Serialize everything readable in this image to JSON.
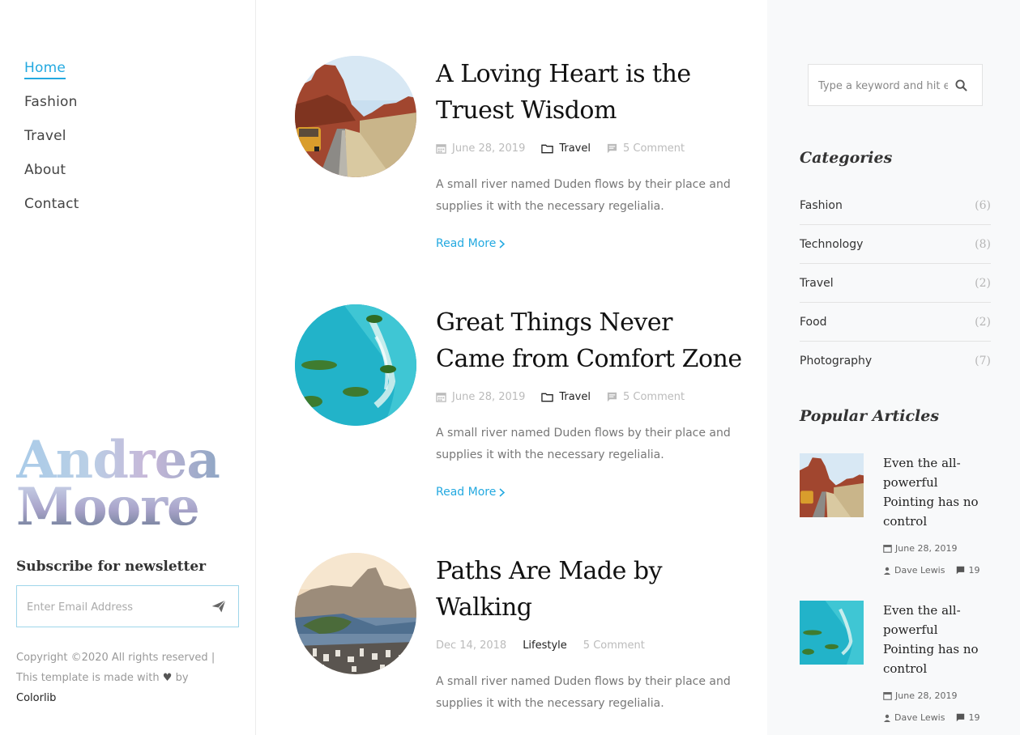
{
  "nav": {
    "items": [
      {
        "label": "Home",
        "active": true
      },
      {
        "label": "Fashion",
        "active": false
      },
      {
        "label": "Travel",
        "active": false
      },
      {
        "label": "About",
        "active": false
      },
      {
        "label": "Contact",
        "active": false
      }
    ]
  },
  "brand": {
    "line1": "Andrea",
    "line2": "Moore"
  },
  "newsletter": {
    "title": "Subscribe for newsletter",
    "placeholder": "Enter Email Address",
    "send_icon": "paper-plane-icon"
  },
  "footer": {
    "copyright": "Copyright ©2020 All rights reserved | This template is made with",
    "heart": "♥",
    "by": "by",
    "link": "Colorlib"
  },
  "posts": [
    {
      "title": "A Loving Heart is the Truest Wisdom",
      "date": "June 28, 2019",
      "category": "Travel",
      "comments": "5 Comment",
      "excerpt": "A small river named Duden flows by their place and supplies it with the necessary regelialia.",
      "read_more": "Read More",
      "image": "canyon-road-van"
    },
    {
      "title": "Great Things Never Came from Comfort Zone",
      "date": "June 28, 2019",
      "category": "Travel",
      "comments": "5 Comment",
      "excerpt": "A small river named Duden flows by their place and supplies it with the necessary regelialia.",
      "read_more": "Read More",
      "image": "turquoise-sea-islands"
    },
    {
      "title": "Paths Are Made by Walking",
      "date": "Dec 14, 2018",
      "category": "Lifestyle",
      "comments": "5 Comment",
      "excerpt": "A small river named Duden flows by their place and supplies it with the necessary regelialia.",
      "image": "coastal-city-mountain"
    }
  ],
  "search": {
    "placeholder": "Type a keyword and hit enter",
    "icon": "search-icon"
  },
  "categories": {
    "heading": "Categories",
    "items": [
      {
        "name": "Fashion",
        "count": "(6)"
      },
      {
        "name": "Technology",
        "count": "(8)"
      },
      {
        "name": "Travel",
        "count": "(2)"
      },
      {
        "name": "Food",
        "count": "(2)"
      },
      {
        "name": "Photography",
        "count": "(7)"
      }
    ]
  },
  "popular": {
    "heading": "Popular Articles",
    "items": [
      {
        "title": "Even the all-powerful Pointing has no control",
        "date": "June 28, 2019",
        "author": "Dave Lewis",
        "comments": "19",
        "image": "canyon-road-van"
      },
      {
        "title": "Even the all-powerful Pointing has no control",
        "date": "June 28, 2019",
        "author": "Dave Lewis",
        "comments": "19",
        "image": "turquoise-sea-islands"
      }
    ]
  },
  "colors": {
    "accent": "#23a9e0",
    "sidebar_bg": "#f8f9fa"
  }
}
